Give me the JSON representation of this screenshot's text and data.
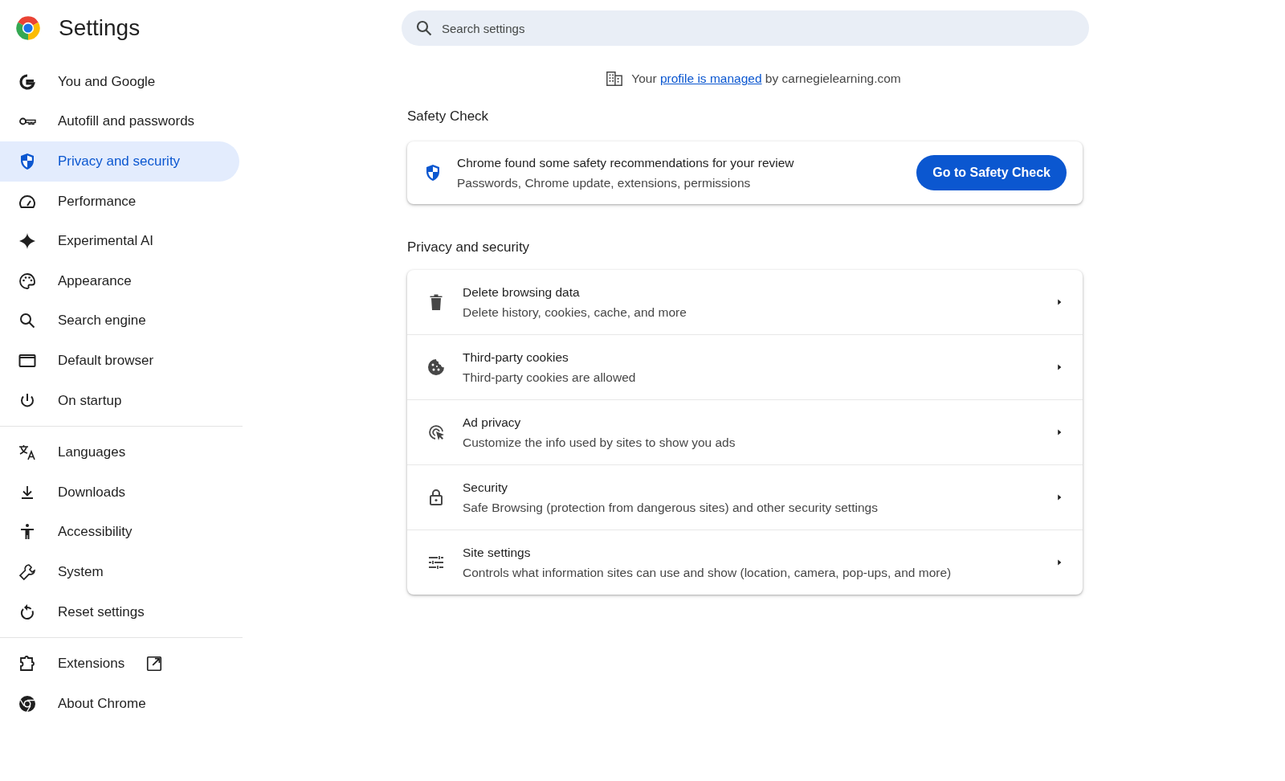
{
  "header": {
    "title": "Settings"
  },
  "sidebar": {
    "groups": [
      {
        "items": [
          {
            "label": "You and Google",
            "selected": false,
            "external": false
          },
          {
            "label": "Autofill and passwords",
            "selected": false,
            "external": false
          },
          {
            "label": "Privacy and security",
            "selected": true,
            "external": false
          },
          {
            "label": "Performance",
            "selected": false,
            "external": false
          },
          {
            "label": "Experimental AI",
            "selected": false,
            "external": false
          },
          {
            "label": "Appearance",
            "selected": false,
            "external": false
          },
          {
            "label": "Search engine",
            "selected": false,
            "external": false
          },
          {
            "label": "Default browser",
            "selected": false,
            "external": false
          },
          {
            "label": "On startup",
            "selected": false,
            "external": false
          }
        ]
      },
      {
        "items": [
          {
            "label": "Languages",
            "selected": false,
            "external": false
          },
          {
            "label": "Downloads",
            "selected": false,
            "external": false
          },
          {
            "label": "Accessibility",
            "selected": false,
            "external": false
          },
          {
            "label": "System",
            "selected": false,
            "external": false
          },
          {
            "label": "Reset settings",
            "selected": false,
            "external": false
          }
        ]
      },
      {
        "items": [
          {
            "label": "Extensions",
            "selected": false,
            "external": true
          },
          {
            "label": "About Chrome",
            "selected": false,
            "external": false
          }
        ]
      }
    ]
  },
  "search": {
    "placeholder": "Search settings"
  },
  "managed_notice": {
    "prefix": "Your",
    "link": "profile is managed",
    "suffix": "by carnegielearning.com"
  },
  "safety_check": {
    "heading": "Safety Check",
    "title": "Chrome found some safety recommendations for your review",
    "subtitle": "Passwords, Chrome update, extensions, permissions",
    "button": "Go to Safety Check"
  },
  "privacy": {
    "heading": "Privacy and security",
    "rows": [
      {
        "title": "Delete browsing data",
        "subtitle": "Delete history, cookies, cache, and more"
      },
      {
        "title": "Third-party cookies",
        "subtitle": "Third-party cookies are allowed"
      },
      {
        "title": "Ad privacy",
        "subtitle": "Customize the info used by sites to show you ads"
      },
      {
        "title": "Security",
        "subtitle": "Safe Browsing (protection from dangerous sites) and other security settings"
      },
      {
        "title": "Site settings",
        "subtitle": "Controls what information sites can use and show (location, camera, pop-ups, and more)"
      }
    ]
  }
}
